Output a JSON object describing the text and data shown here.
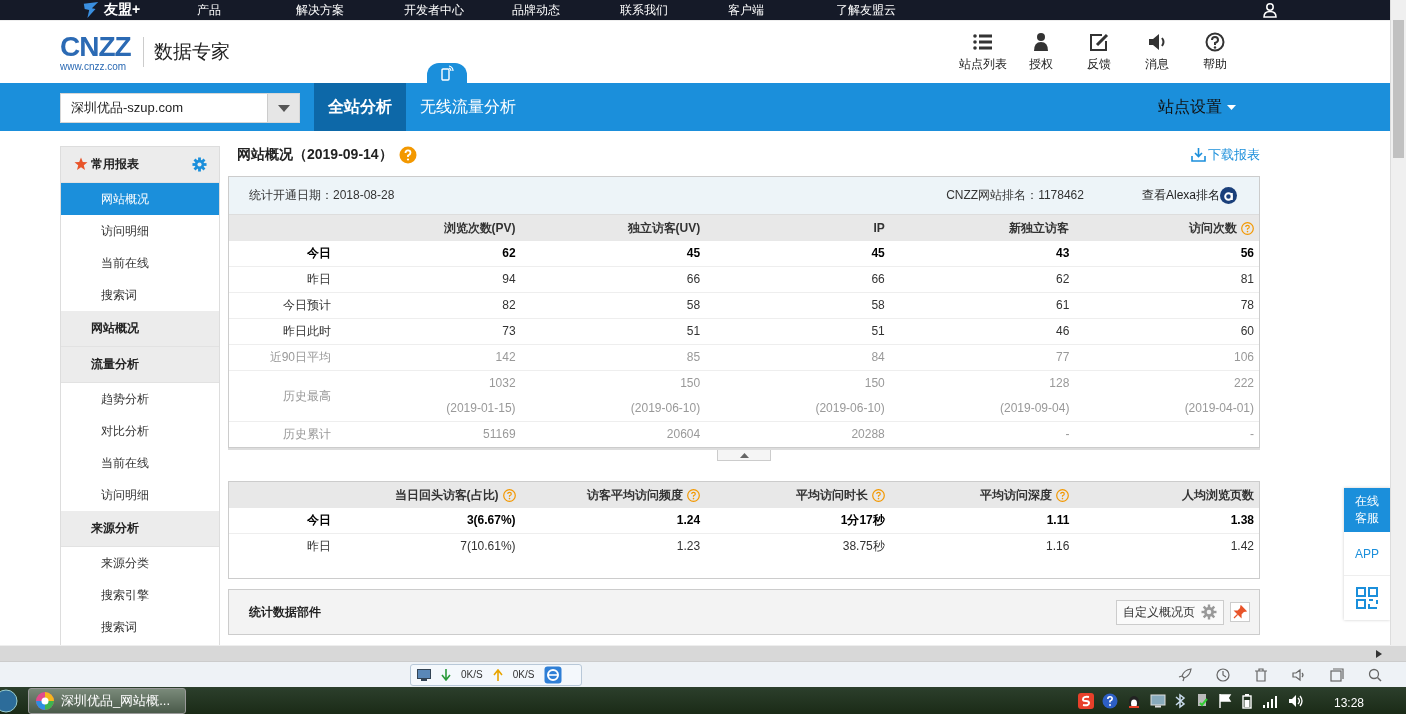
{
  "topnav": {
    "brand": "友盟+",
    "items": [
      "产品",
      "解决方案",
      "开发者中心",
      "品牌动态",
      "联系我们",
      "客户端",
      "了解友盟云"
    ]
  },
  "header": {
    "logo": "CNZZ",
    "logo_url": "www.cnzz.com",
    "product": "数据专家",
    "tools": [
      {
        "kind": "list",
        "label": "站点列表"
      },
      {
        "kind": "user",
        "label": "授权"
      },
      {
        "kind": "edit",
        "label": "反馈"
      },
      {
        "kind": "sound",
        "label": "消息"
      },
      {
        "kind": "help",
        "label": "帮助"
      }
    ]
  },
  "bluebar": {
    "site": "深圳优品-szup.com",
    "tabs": [
      {
        "label": "全站分析",
        "selected": true,
        "mobile": false
      },
      {
        "label": "无线流量分析",
        "selected": false,
        "mobile": true
      }
    ],
    "settings": "站点设置"
  },
  "sidebar": [
    {
      "title": "常用报表",
      "starred": true,
      "items": [
        {
          "label": "网站概况",
          "selected": true
        },
        {
          "label": "访问明细",
          "selected": false
        },
        {
          "label": "当前在线",
          "selected": false
        },
        {
          "label": "搜索词",
          "selected": false
        }
      ]
    },
    {
      "title": "网站概况",
      "starred": false
    },
    {
      "title": "流量分析",
      "starred": false,
      "items": [
        {
          "label": "趋势分析",
          "selected": false
        },
        {
          "label": "对比分析",
          "selected": false
        },
        {
          "label": "当前在线",
          "selected": false
        },
        {
          "label": "访问明细",
          "selected": false
        }
      ]
    },
    {
      "title": "来源分析",
      "starred": false,
      "items": [
        {
          "label": "来源分类",
          "selected": false
        },
        {
          "label": "搜索引擎",
          "selected": false
        },
        {
          "label": "搜索词",
          "selected": false
        }
      ]
    }
  ],
  "overview": {
    "title": "网站概况（2019-09-14）",
    "download": "下载报表",
    "start_date": "统计开通日期：2018-08-28",
    "rank": "CNZZ网站排名：1178462",
    "alexa": "查看Alexa排名",
    "columns": [
      {
        "label": "浏览次数(PV)",
        "help": false
      },
      {
        "label": "独立访客(UV)",
        "help": false
      },
      {
        "label": "IP",
        "help": false
      },
      {
        "label": "新独立访客",
        "help": false
      },
      {
        "label": "访问次数",
        "help": true
      }
    ],
    "rows": [
      {
        "label": "今日",
        "kind": "strong",
        "values": [
          "62",
          "45",
          "45",
          "43",
          "56"
        ]
      },
      {
        "label": "昨日",
        "kind": "normal",
        "values": [
          "94",
          "66",
          "66",
          "62",
          "81"
        ]
      },
      {
        "label": "今日预计",
        "kind": "normal",
        "values": [
          "82",
          "58",
          "58",
          "61",
          "78"
        ]
      },
      {
        "label": "昨日此时",
        "kind": "normal",
        "values": [
          "73",
          "51",
          "51",
          "46",
          "60"
        ]
      },
      {
        "label": "近90日平均",
        "kind": "muted",
        "values": [
          "142",
          "85",
          "84",
          "77",
          "106"
        ]
      },
      {
        "label": "历史最高",
        "kind": "muted",
        "values": [
          "1032",
          "150",
          "150",
          "128",
          "222"
        ],
        "dates": [
          "(2019-01-15)",
          "(2019-06-10)",
          "(2019-06-10)",
          "(2019-09-04)",
          "(2019-04-01)"
        ]
      },
      {
        "label": "历史累计",
        "kind": "muted",
        "values": [
          "51169",
          "20604",
          "20288",
          "-",
          "-"
        ]
      }
    ]
  },
  "metrics": {
    "columns": [
      {
        "label": "当日回头访客(占比)",
        "help": true
      },
      {
        "label": "访客平均访问频度",
        "help": true
      },
      {
        "label": "平均访问时长",
        "help": true
      },
      {
        "label": "平均访问深度",
        "help": true
      },
      {
        "label": "人均浏览页数",
        "help": false
      }
    ],
    "rows": [
      {
        "label": "今日",
        "kind": "strong",
        "values": [
          "3(6.67%)",
          "1.24",
          "1分17秒",
          "1.11",
          "1.38"
        ]
      },
      {
        "label": "昨日",
        "kind": "normal",
        "values": [
          "7(10.61%)",
          "1.23",
          "38.75秒",
          "1.16",
          "1.42"
        ]
      }
    ]
  },
  "widget": {
    "title": "统计数据部件",
    "button": "自定义概况页"
  },
  "float_panel": {
    "service": "在线客服",
    "app": "APP"
  },
  "statusbar": {
    "down": "0K/S",
    "up": "0K/S"
  },
  "taskbar": {
    "task": "深圳优品_网站概...",
    "time": "13:28"
  }
}
